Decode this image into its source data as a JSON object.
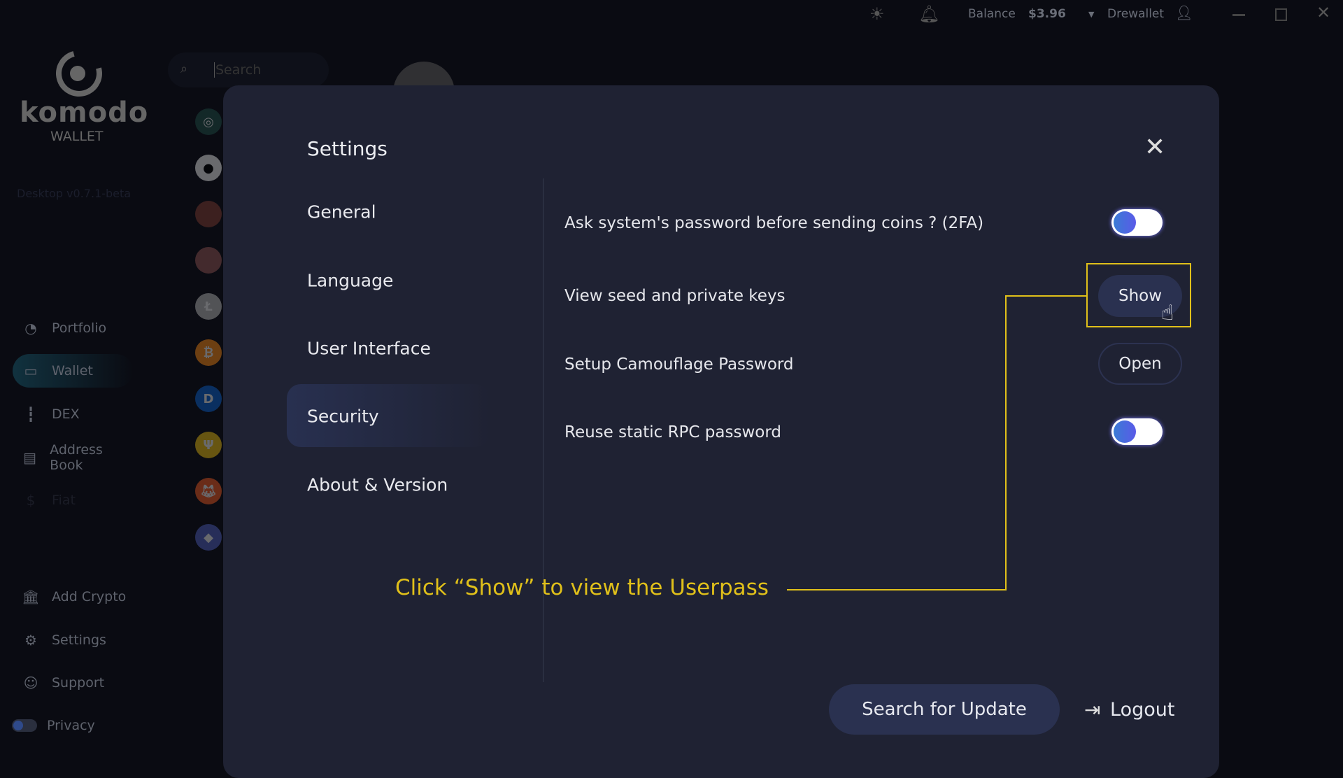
{
  "topbar": {
    "balance_label": "Balance",
    "balance_value": "$3.96",
    "wallet_name": "Drewallet"
  },
  "sidebar": {
    "logo_text": "komodo",
    "logo_sub": "WALLET",
    "version": "Desktop v0.7.1-beta",
    "items": [
      {
        "label": "Portfolio",
        "icon": "portfolio-icon"
      },
      {
        "label": "Wallet",
        "icon": "wallet-icon"
      },
      {
        "label": "DEX",
        "icon": "dex-icon"
      },
      {
        "label": "Address Book",
        "icon": "address-book-icon"
      },
      {
        "label": "Fiat",
        "icon": "fiat-icon"
      }
    ],
    "bottom": [
      {
        "label": "Add Crypto"
      },
      {
        "label": "Settings"
      },
      {
        "label": "Support"
      },
      {
        "label": "Privacy"
      }
    ]
  },
  "search": {
    "placeholder": "Search"
  },
  "coins": [
    "KMD",
    "PANDA",
    "avatar",
    "avatar2",
    "LTC",
    "BTC",
    "DGB",
    "Ψ",
    "SHIB",
    "ETH"
  ],
  "settings": {
    "title": "Settings",
    "menu": [
      "General",
      "Language",
      "User Interface",
      "Security",
      "About & Version"
    ],
    "active": "Security",
    "rows": [
      {
        "label": "Ask system's password before sending coins ? (2FA)",
        "type": "toggle",
        "on": true
      },
      {
        "label": "View seed and private keys",
        "type": "button",
        "button": "Show"
      },
      {
        "label": "Setup Camouflage Password",
        "type": "button",
        "button": "Open"
      },
      {
        "label": "Reuse static RPC password",
        "type": "toggle",
        "on": true
      }
    ],
    "search_update": "Search for Update",
    "logout": "Logout"
  },
  "annotation": {
    "text": "Click “Show” to view the Userpass",
    "color": "#e0c01a"
  }
}
